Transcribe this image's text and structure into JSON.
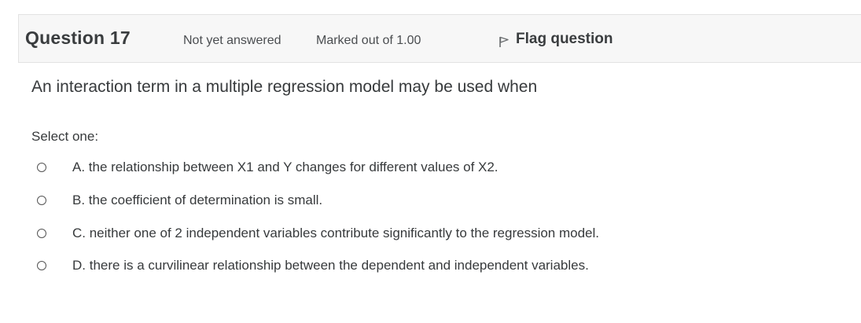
{
  "question": {
    "title": "Question 17",
    "state": "Not yet answered",
    "grade": "Marked out of 1.00",
    "flag_label": "Flag question",
    "flag_icon": "flag-icon",
    "text": "An interaction term in a multiple regression model may be used when",
    "prompt": "Select one:",
    "answers": [
      {
        "label": "A. the relationship between X1 and Y changes for different values of X2."
      },
      {
        "label": "B. the coefficient of determination is small."
      },
      {
        "label": "C. neither one of 2 independent variables contribute significantly to the regression model."
      },
      {
        "label": "D. there is a curvilinear relationship between the dependent and independent variables."
      }
    ]
  }
}
